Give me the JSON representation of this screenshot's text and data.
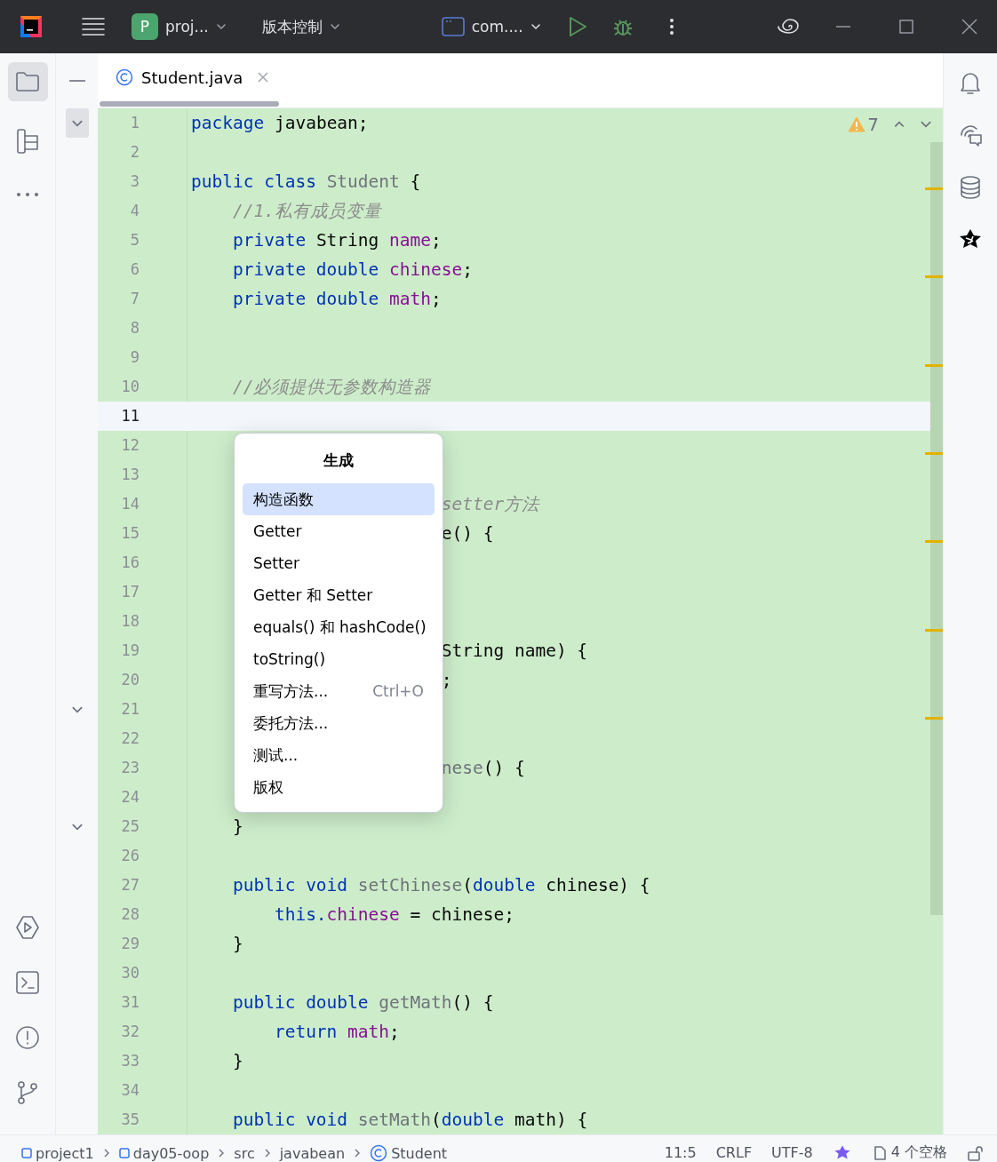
{
  "title_bar": {
    "project_badge": "P",
    "project": "proj...",
    "vcs": "版本控制",
    "run_config": "com...."
  },
  "editor": {
    "tab": {
      "name": "Student.java",
      "selected": true
    },
    "warnings": "7",
    "lines": [
      {
        "number": "1",
        "current": false,
        "fold": true,
        "tokens": [
          {
            "kind": "kw",
            "text": "package"
          },
          {
            "kind": "plain",
            "text": " javabean;"
          }
        ]
      },
      {
        "number": "2",
        "current": false,
        "fold": false
      },
      {
        "number": "3",
        "current": false,
        "fold": false,
        "tokens": [
          {
            "kind": "kw",
            "text": "public class "
          },
          {
            "kind": "unused",
            "text": "Student"
          },
          {
            "kind": "plain",
            "text": " {"
          }
        ]
      },
      {
        "number": "4",
        "current": false,
        "fold": false,
        "tokens": [
          {
            "kind": "comment",
            "text": "    //1.私有成员变量"
          }
        ]
      },
      {
        "number": "5",
        "current": false,
        "fold": false,
        "tokens": [
          {
            "kind": "kw",
            "text": "    private"
          },
          {
            "kind": "plain",
            "text": " String "
          },
          {
            "kind": "field",
            "text": "name"
          },
          {
            "kind": "plain",
            "text": ";"
          }
        ]
      },
      {
        "number": "6",
        "current": false,
        "fold": false,
        "tokens": [
          {
            "kind": "kw",
            "text": "    private double "
          },
          {
            "kind": "field",
            "text": "chinese"
          },
          {
            "kind": "plain",
            "text": ";"
          }
        ]
      },
      {
        "number": "7",
        "current": false,
        "fold": false,
        "tokens": [
          {
            "kind": "kw",
            "text": "    private double "
          },
          {
            "kind": "field",
            "text": "math"
          },
          {
            "kind": "plain",
            "text": ";"
          }
        ]
      },
      {
        "number": "8",
        "current": false,
        "fold": false
      },
      {
        "number": "9",
        "current": false,
        "fold": false
      },
      {
        "number": "10",
        "current": false,
        "fold": false,
        "tokens": [
          {
            "kind": "comment",
            "text": "    //必须提供无参数构造器"
          }
        ]
      },
      {
        "number": "11",
        "current": true,
        "fold": false
      },
      {
        "number": "12",
        "current": false,
        "fold": false
      },
      {
        "number": "13",
        "current": false,
        "fold": false
      },
      {
        "number": "14",
        "current": false,
        "fold": false,
        "tokens": [
          {
            "kind": "comment",
            "text": "                        setter方法"
          }
        ]
      },
      {
        "number": "15",
        "current": false,
        "fold": false,
        "tokens": [
          {
            "kind": "plain",
            "text": "                        e() {"
          }
        ]
      },
      {
        "number": "16",
        "current": false,
        "fold": false
      },
      {
        "number": "17",
        "current": false,
        "fold": false
      },
      {
        "number": "18",
        "current": false,
        "fold": false
      },
      {
        "number": "19",
        "current": false,
        "fold": false,
        "tokens": [
          {
            "kind": "plain",
            "text": "                        String name) {"
          }
        ]
      },
      {
        "number": "20",
        "current": false,
        "fold": false,
        "tokens": [
          {
            "kind": "plain",
            "text": "                        ;"
          }
        ]
      },
      {
        "number": "21",
        "current": false,
        "fold": true
      },
      {
        "number": "22",
        "current": false,
        "fold": false
      },
      {
        "number": "23",
        "current": false,
        "fold": false,
        "tokens": [
          {
            "kind": "unused",
            "text": "                        nese"
          },
          {
            "kind": "plain",
            "text": "() {"
          }
        ]
      },
      {
        "number": "24",
        "current": false,
        "fold": false
      },
      {
        "number": "25",
        "current": false,
        "fold": true,
        "tokens": [
          {
            "kind": "plain",
            "text": "    }"
          }
        ]
      },
      {
        "number": "26",
        "current": false,
        "fold": false
      },
      {
        "number": "27",
        "current": false,
        "fold": false,
        "tokens": [
          {
            "kind": "kw",
            "text": "    public void "
          },
          {
            "kind": "unused",
            "text": "setChinese"
          },
          {
            "kind": "plain",
            "text": "("
          },
          {
            "kind": "kw",
            "text": "double"
          },
          {
            "kind": "plain",
            "text": " chinese) {"
          }
        ]
      },
      {
        "number": "28",
        "current": false,
        "fold": false,
        "tokens": [
          {
            "kind": "kw",
            "text": "        this."
          },
          {
            "kind": "field",
            "text": "chinese"
          },
          {
            "kind": "plain",
            "text": " = chinese;"
          }
        ]
      },
      {
        "number": "29",
        "current": false,
        "fold": false,
        "tokens": [
          {
            "kind": "plain",
            "text": "    }"
          }
        ]
      },
      {
        "number": "30",
        "current": false,
        "fold": false
      },
      {
        "number": "31",
        "current": false,
        "fold": false,
        "tokens": [
          {
            "kind": "kw",
            "text": "    public double "
          },
          {
            "kind": "unused",
            "text": "getMath"
          },
          {
            "kind": "plain",
            "text": "() {"
          }
        ]
      },
      {
        "number": "32",
        "current": false,
        "fold": false,
        "tokens": [
          {
            "kind": "kw",
            "text": "        return "
          },
          {
            "kind": "field",
            "text": "math"
          },
          {
            "kind": "plain",
            "text": ";"
          }
        ]
      },
      {
        "number": "33",
        "current": false,
        "fold": false,
        "tokens": [
          {
            "kind": "plain",
            "text": "    }"
          }
        ]
      },
      {
        "number": "34",
        "current": false,
        "fold": false
      },
      {
        "number": "35",
        "current": false,
        "fold": false,
        "tokens": [
          {
            "kind": "kw",
            "text": "    public void "
          },
          {
            "kind": "unused",
            "text": "setMath"
          },
          {
            "kind": "plain",
            "text": "("
          },
          {
            "kind": "kw",
            "text": "double"
          },
          {
            "kind": "plain",
            "text": " math) {"
          }
        ]
      }
    ]
  },
  "generate_popup": {
    "title": "生成",
    "items": [
      {
        "label": "构造函数",
        "selected": true
      },
      {
        "label": "Getter",
        "selected": false
      },
      {
        "label": "Setter",
        "selected": false
      },
      {
        "label": "Getter 和 Setter",
        "selected": false
      },
      {
        "label": "equals() 和 hashCode()",
        "selected": false
      },
      {
        "label": "toString()",
        "selected": false
      },
      {
        "label": "重写方法...",
        "shortcut": "Ctrl+O",
        "selected": false
      },
      {
        "label": "委托方法...",
        "selected": false
      },
      {
        "label": "测试...",
        "selected": false
      },
      {
        "label": "版权",
        "selected": false
      }
    ]
  },
  "status_bar": {
    "breadcrumbs": [
      {
        "label": "project1",
        "kind": "module"
      },
      {
        "label": "day05-oop",
        "kind": "module"
      },
      {
        "label": "src",
        "kind": "plain"
      },
      {
        "label": "javabean",
        "kind": "plain"
      },
      {
        "label": "Student",
        "kind": "class"
      }
    ],
    "position": "11:5",
    "line_ending": "CRLF",
    "encoding": "UTF-8",
    "indent": "4 个空格"
  }
}
